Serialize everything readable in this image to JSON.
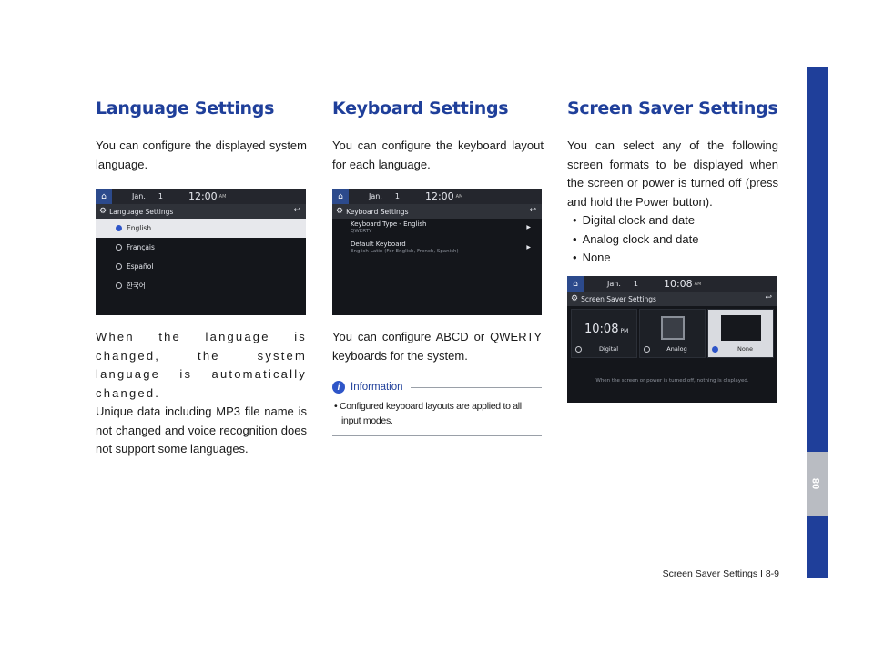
{
  "language": {
    "heading": "Language Settings",
    "intro": "You can configure the displayed system language.",
    "para1": "When the language is changed, the system language is automatically changed.",
    "para2": "Unique data including MP3 file name is not changed and voice recognition does not support some languages.",
    "screen": {
      "date": "Jan.",
      "day": "1",
      "time": "12:00",
      "ampm": "AM",
      "title": "Language Settings",
      "options": [
        "English",
        "Français",
        "Español",
        "한국어"
      ]
    }
  },
  "keyboard": {
    "heading": "Keyboard Settings",
    "intro": "You can configure the keyboard layout for each language.",
    "para1": "You can configure ABCD or QWERTY keyboards for the system.",
    "screen": {
      "date": "Jan.",
      "day": "1",
      "time": "12:00",
      "ampm": "AM",
      "title": "Keyboard Settings",
      "item1": "Keyboard Type - English",
      "item1_sub": "QWERTY",
      "item2": "Default Keyboard",
      "item2_sub": "English-Latin (For English, French, Spanish)"
    },
    "info": {
      "title": "Information",
      "text": "• Configured keyboard layouts are applied to all input modes."
    }
  },
  "screensaver": {
    "heading": "Screen Saver Settings",
    "intro": "You can select any of the following screen formats to be displayed when the screen or power is turned off (press and hold the Power button).",
    "bullets": [
      "Digital clock and date",
      "Analog clock and date",
      "None"
    ],
    "screen": {
      "date": "Jan.",
      "day": "1",
      "time": "10:08",
      "ampm": "AM",
      "title": "Screen Saver Settings",
      "tile_digital_time": "10:08",
      "tile_digital_pm": "PM",
      "tiles": [
        "Digital",
        "Analog",
        "None"
      ],
      "message": "When the screen or power is turned off, nothing is displayed."
    }
  },
  "sidebar": {
    "tab": "08"
  },
  "footer": {
    "text": "Screen Saver Settings I 8-9"
  }
}
